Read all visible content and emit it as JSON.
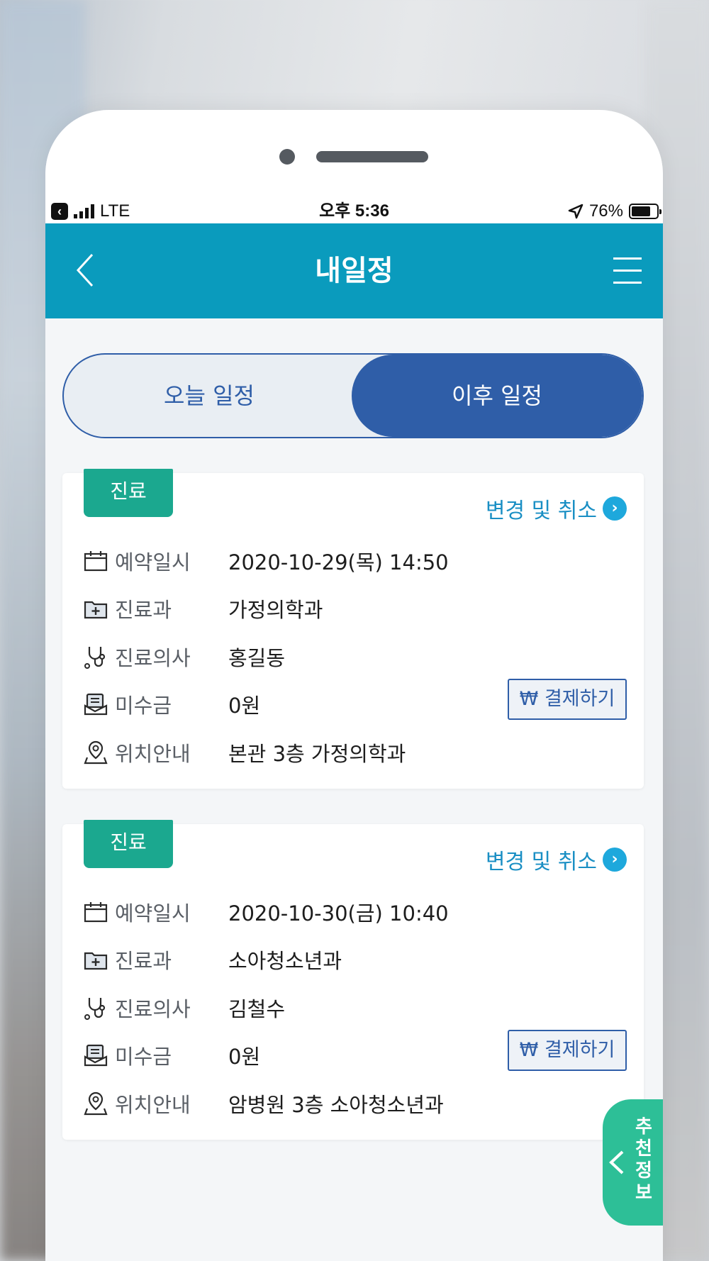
{
  "status_bar": {
    "carrier_icon": "back-to-app-icon",
    "network": "LTE",
    "time": "오후 5:36",
    "location_icon": "location-arrow-icon",
    "battery": "76%",
    "battery_level": 0.76
  },
  "header": {
    "title": "내일정",
    "back_icon": "chevron-left-icon",
    "menu_icon": "hamburger-menu-icon"
  },
  "tabs": {
    "today": "오늘 일정",
    "upcoming": "이후 일정",
    "selected": "upcoming"
  },
  "appointments": [
    {
      "tag": "진료",
      "change_label": "변경 및 취소",
      "date_label": "예약일시",
      "date_value": "2020-10-29(목) 14:50",
      "dept_label": "진료과",
      "dept_value": "가정의학과",
      "doctor_label": "진료의사",
      "doctor_value": "홍길동",
      "unpaid_label": "미수금",
      "unpaid_value": "0원",
      "location_label": "위치안내",
      "location_value": "본관 3층 가정의학과",
      "pay_label": "₩ 결제하기"
    },
    {
      "tag": "진료",
      "change_label": "변경 및 취소",
      "date_label": "예약일시",
      "date_value": "2020-10-30(금) 10:40",
      "dept_label": "진료과",
      "dept_value": "소아청소년과",
      "doctor_label": "진료의사",
      "doctor_value": "김철수",
      "unpaid_label": "미수금",
      "unpaid_value": "0원",
      "location_label": "위치안내",
      "location_value": "암병원 3층 소아청소년과",
      "pay_label": "₩ 결제하기"
    }
  ],
  "side_tab": {
    "label": "추천정보"
  },
  "colors": {
    "header": "#0a9bbd",
    "primary": "#2f5ea8",
    "tag": "#1ba88f",
    "side_tab": "#2dbf97"
  }
}
